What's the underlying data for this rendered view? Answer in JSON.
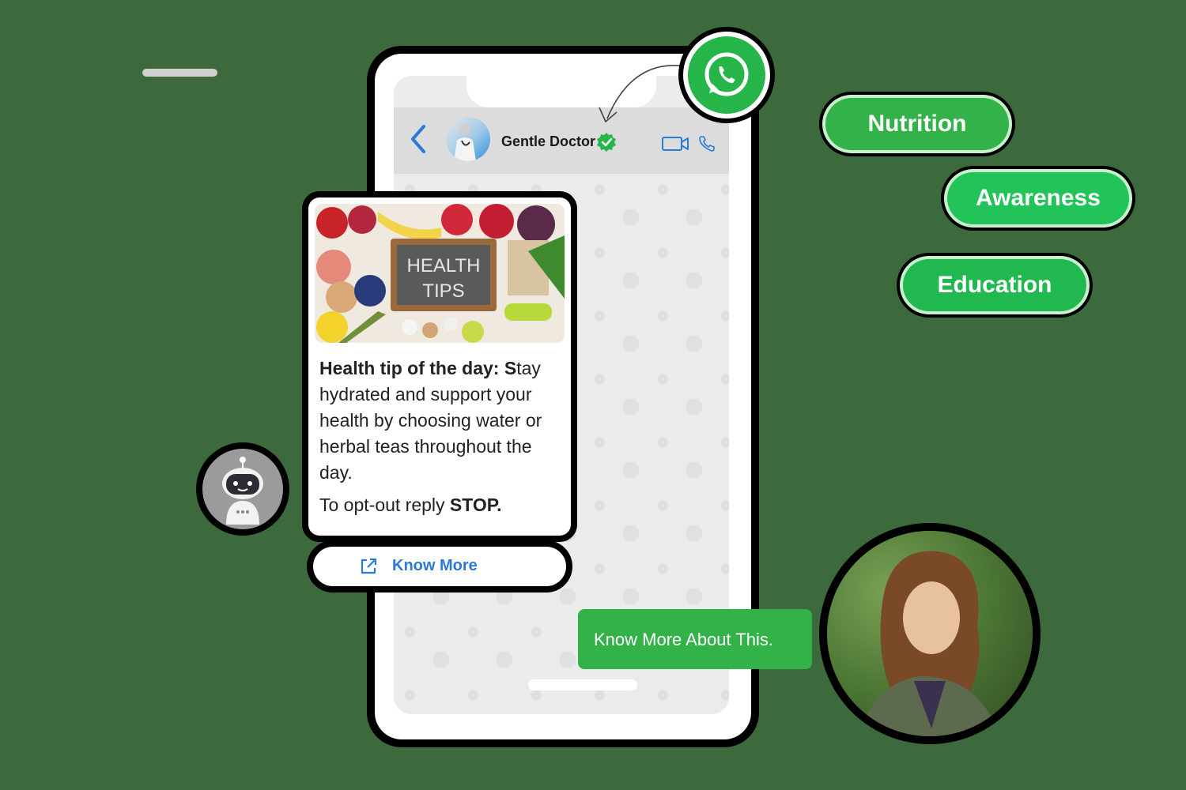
{
  "chat": {
    "contact_name": "Gentle Doctor",
    "contact_verified": true
  },
  "message": {
    "image_title_line1": "HEALTH",
    "image_title_line2": "TIPS",
    "bold_intro": "Health tip of the day: S",
    "body": "tay hydrated and support your health by choosing water or herbal teas throughout the day.",
    "optout_prefix": "To opt-out reply ",
    "optout_keyword": "STOP."
  },
  "button": {
    "label": "Know More",
    "icon": "external-link-icon"
  },
  "reply": {
    "text": "Know More About This."
  },
  "tags": [
    {
      "label": "Nutrition"
    },
    {
      "label": "Awareness"
    },
    {
      "label": "Education"
    }
  ],
  "colors": {
    "whatsapp_green": "#25b548",
    "bubble_green": "#33b24a",
    "link_blue": "#2a7ad6",
    "background": "#3d6a3d"
  }
}
